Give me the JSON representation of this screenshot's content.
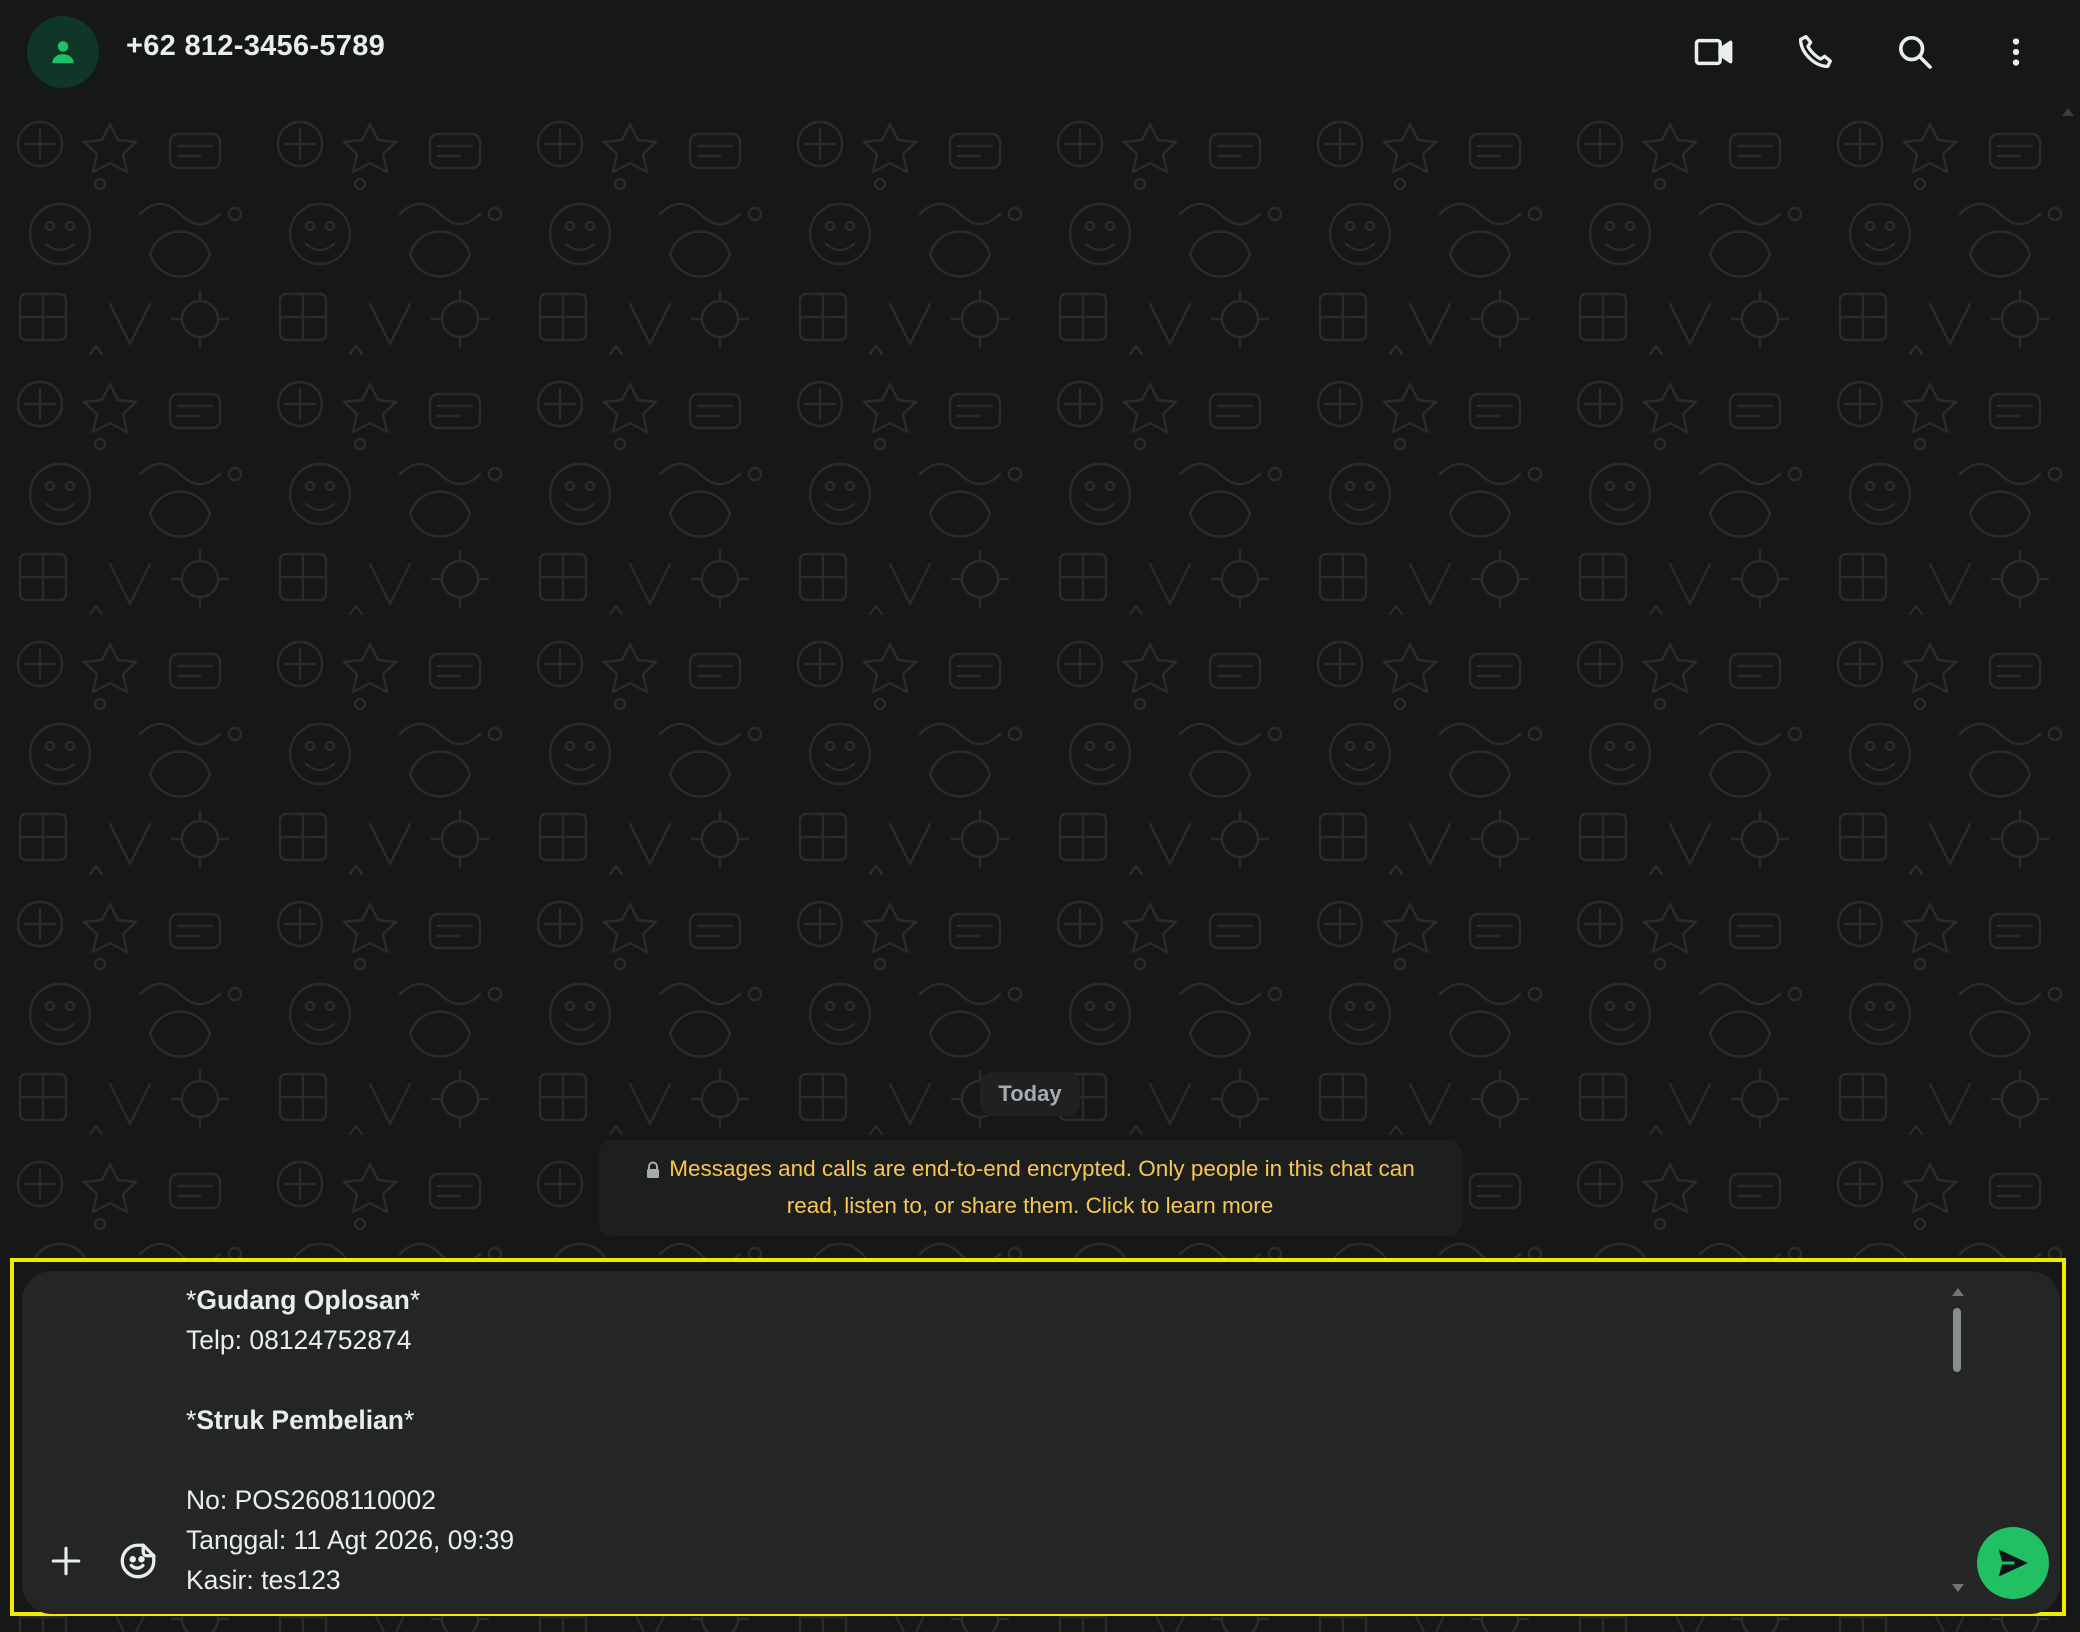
{
  "header": {
    "contact_name": "+62 812-3456-5789",
    "icons": [
      "avatar-person-icon",
      "video-call-icon",
      "voice-call-icon",
      "search-icon",
      "more-options-icon"
    ]
  },
  "chat": {
    "day_label": "Today",
    "encryption_notice": {
      "line1": "Messages and calls are end-to-end encrypted. Only people in this chat can",
      "line2": "read, listen to, or share them. Click to learn more",
      "icon": "lock-icon"
    }
  },
  "composer": {
    "lines": [
      {
        "prefix": "*",
        "bold": "Gudang Oplosan",
        "suffix": "*"
      },
      {
        "prefix": "Telp: 08124752874",
        "bold": "",
        "suffix": ""
      },
      {
        "prefix": "",
        "bold": "",
        "suffix": ""
      },
      {
        "prefix": "*",
        "bold": "Struk Pembelian",
        "suffix": "*"
      },
      {
        "prefix": "",
        "bold": "",
        "suffix": ""
      },
      {
        "prefix": "No: POS2608110002",
        "bold": "",
        "suffix": ""
      },
      {
        "prefix": "Tanggal: 11 Agt 2026, 09:39",
        "bold": "",
        "suffix": ""
      },
      {
        "prefix": "Kasir: tes123",
        "bold": "",
        "suffix": ""
      }
    ],
    "icons": [
      "plus-icon",
      "sticker-icon",
      "send-icon"
    ]
  },
  "colors": {
    "background": "#161717",
    "accent_green": "#21c063",
    "notice_text": "#f7c752",
    "highlight_border": "#f0eb00"
  }
}
